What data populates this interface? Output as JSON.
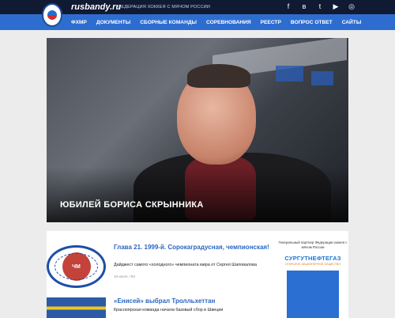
{
  "header": {
    "site_name": "rusbandy.ru",
    "federation": "ФЕДЕРАЦИЯ ХОККЕЯ С МЯЧОМ РОССИИ",
    "social_icons": [
      "facebook-icon",
      "vk-icon",
      "twitter-icon",
      "youtube-icon",
      "instagram-icon"
    ]
  },
  "nav": {
    "items": [
      "ФХМР",
      "ДОКУМЕНТЫ",
      "СБОРНЫЕ КОМАНДЫ",
      "СОРЕВНОВАНИЯ",
      "РЕЕСТР",
      "ВОПРОС ОТВЕТ",
      "САЙТЫ"
    ]
  },
  "hero": {
    "caption": "ЮБИЛЕЙ БОРИСА СКРЫННИКА"
  },
  "news": [
    {
      "title": "Глава 21. 1999-й. Сорокаградусная, чемпионская!",
      "desc": "Дайджест самого «холодного» чемпионата мира от Сергея Шаповалова",
      "date": "19 июля, ЧМ"
    },
    {
      "title": "«Енисей» выбрал Тролльхеттан",
      "desc": "Красноярская команда начала базовый сбор в Швеции"
    }
  ],
  "sidebar": {
    "partner_text": "Генеральный партнер Федерации хоккея с мячом России",
    "brand": "СУРГУТНЕФТЕГАЗ",
    "brand_sub": "ОТКРЫТОЕ АКЦИОНЕРНОЕ ОБЩЕСТВО"
  },
  "colors": {
    "topbar": "#111a33",
    "navbar": "#2e6dd0",
    "link": "#2a66c4"
  }
}
